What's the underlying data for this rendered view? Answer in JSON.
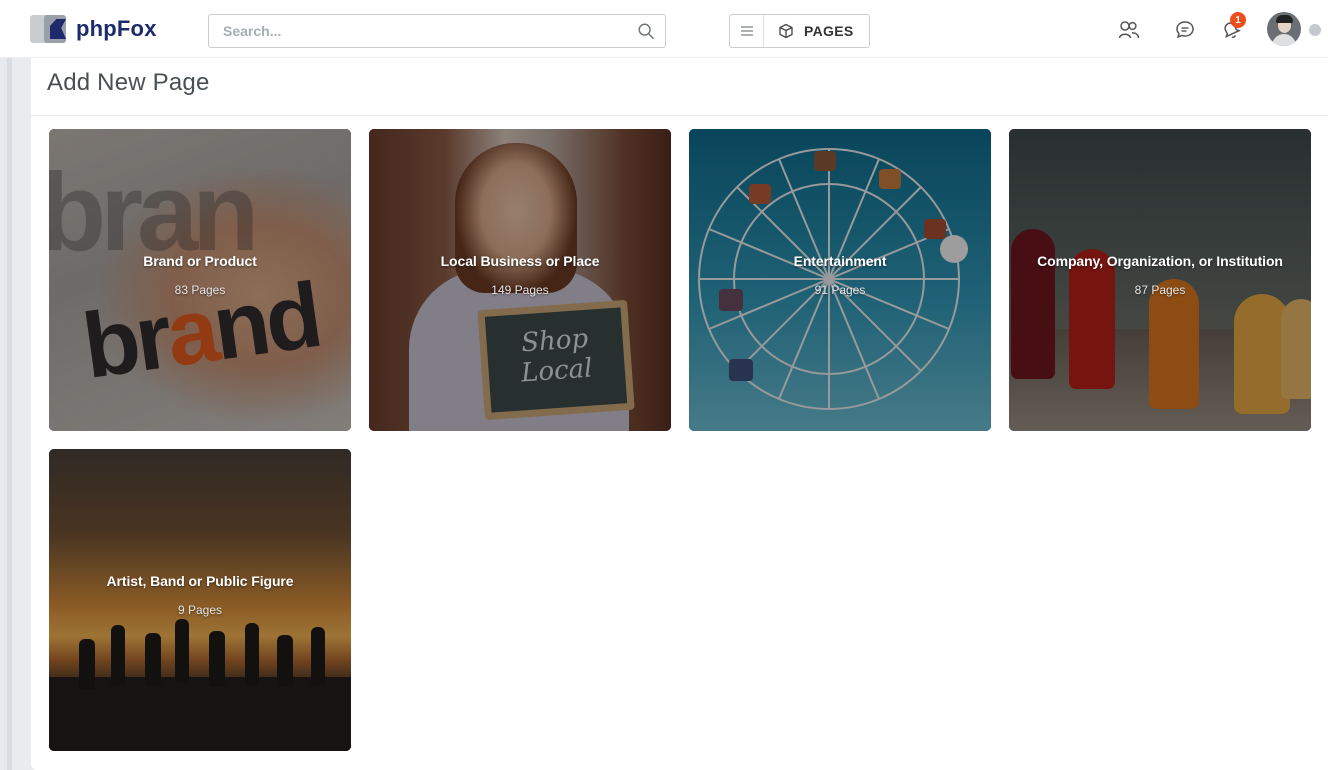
{
  "header": {
    "logo_text": "phpFox",
    "search_placeholder": "Search...",
    "app_menu_label": "PAGES",
    "notification_count": "1",
    "icons": [
      "users-icon",
      "chat-icon",
      "bell-icon",
      "search-icon",
      "menu-icon",
      "box-icon"
    ]
  },
  "main": {
    "title": "Add New Page",
    "categories": [
      {
        "title": "Brand or Product",
        "count": "83 Pages"
      },
      {
        "title": "Local Business or Place",
        "count": "149 Pages"
      },
      {
        "title": "Entertainment",
        "count": "91 Pages"
      },
      {
        "title": "Company, Organization, or Institution",
        "count": "87 Pages"
      },
      {
        "title": "Artist, Band or Public Figure",
        "count": "9 Pages"
      }
    ],
    "image_text": {
      "brand_word_prefix": "br",
      "brand_word_highlight": "a",
      "brand_word_suffix": "nd",
      "brand_bg_word": "bran",
      "board_line1": "Shop",
      "board_line2": "Local"
    }
  },
  "colors": {
    "brand": "#1d2a6b",
    "badge": "#ee4e1b",
    "title_text": "#4a4f55"
  }
}
